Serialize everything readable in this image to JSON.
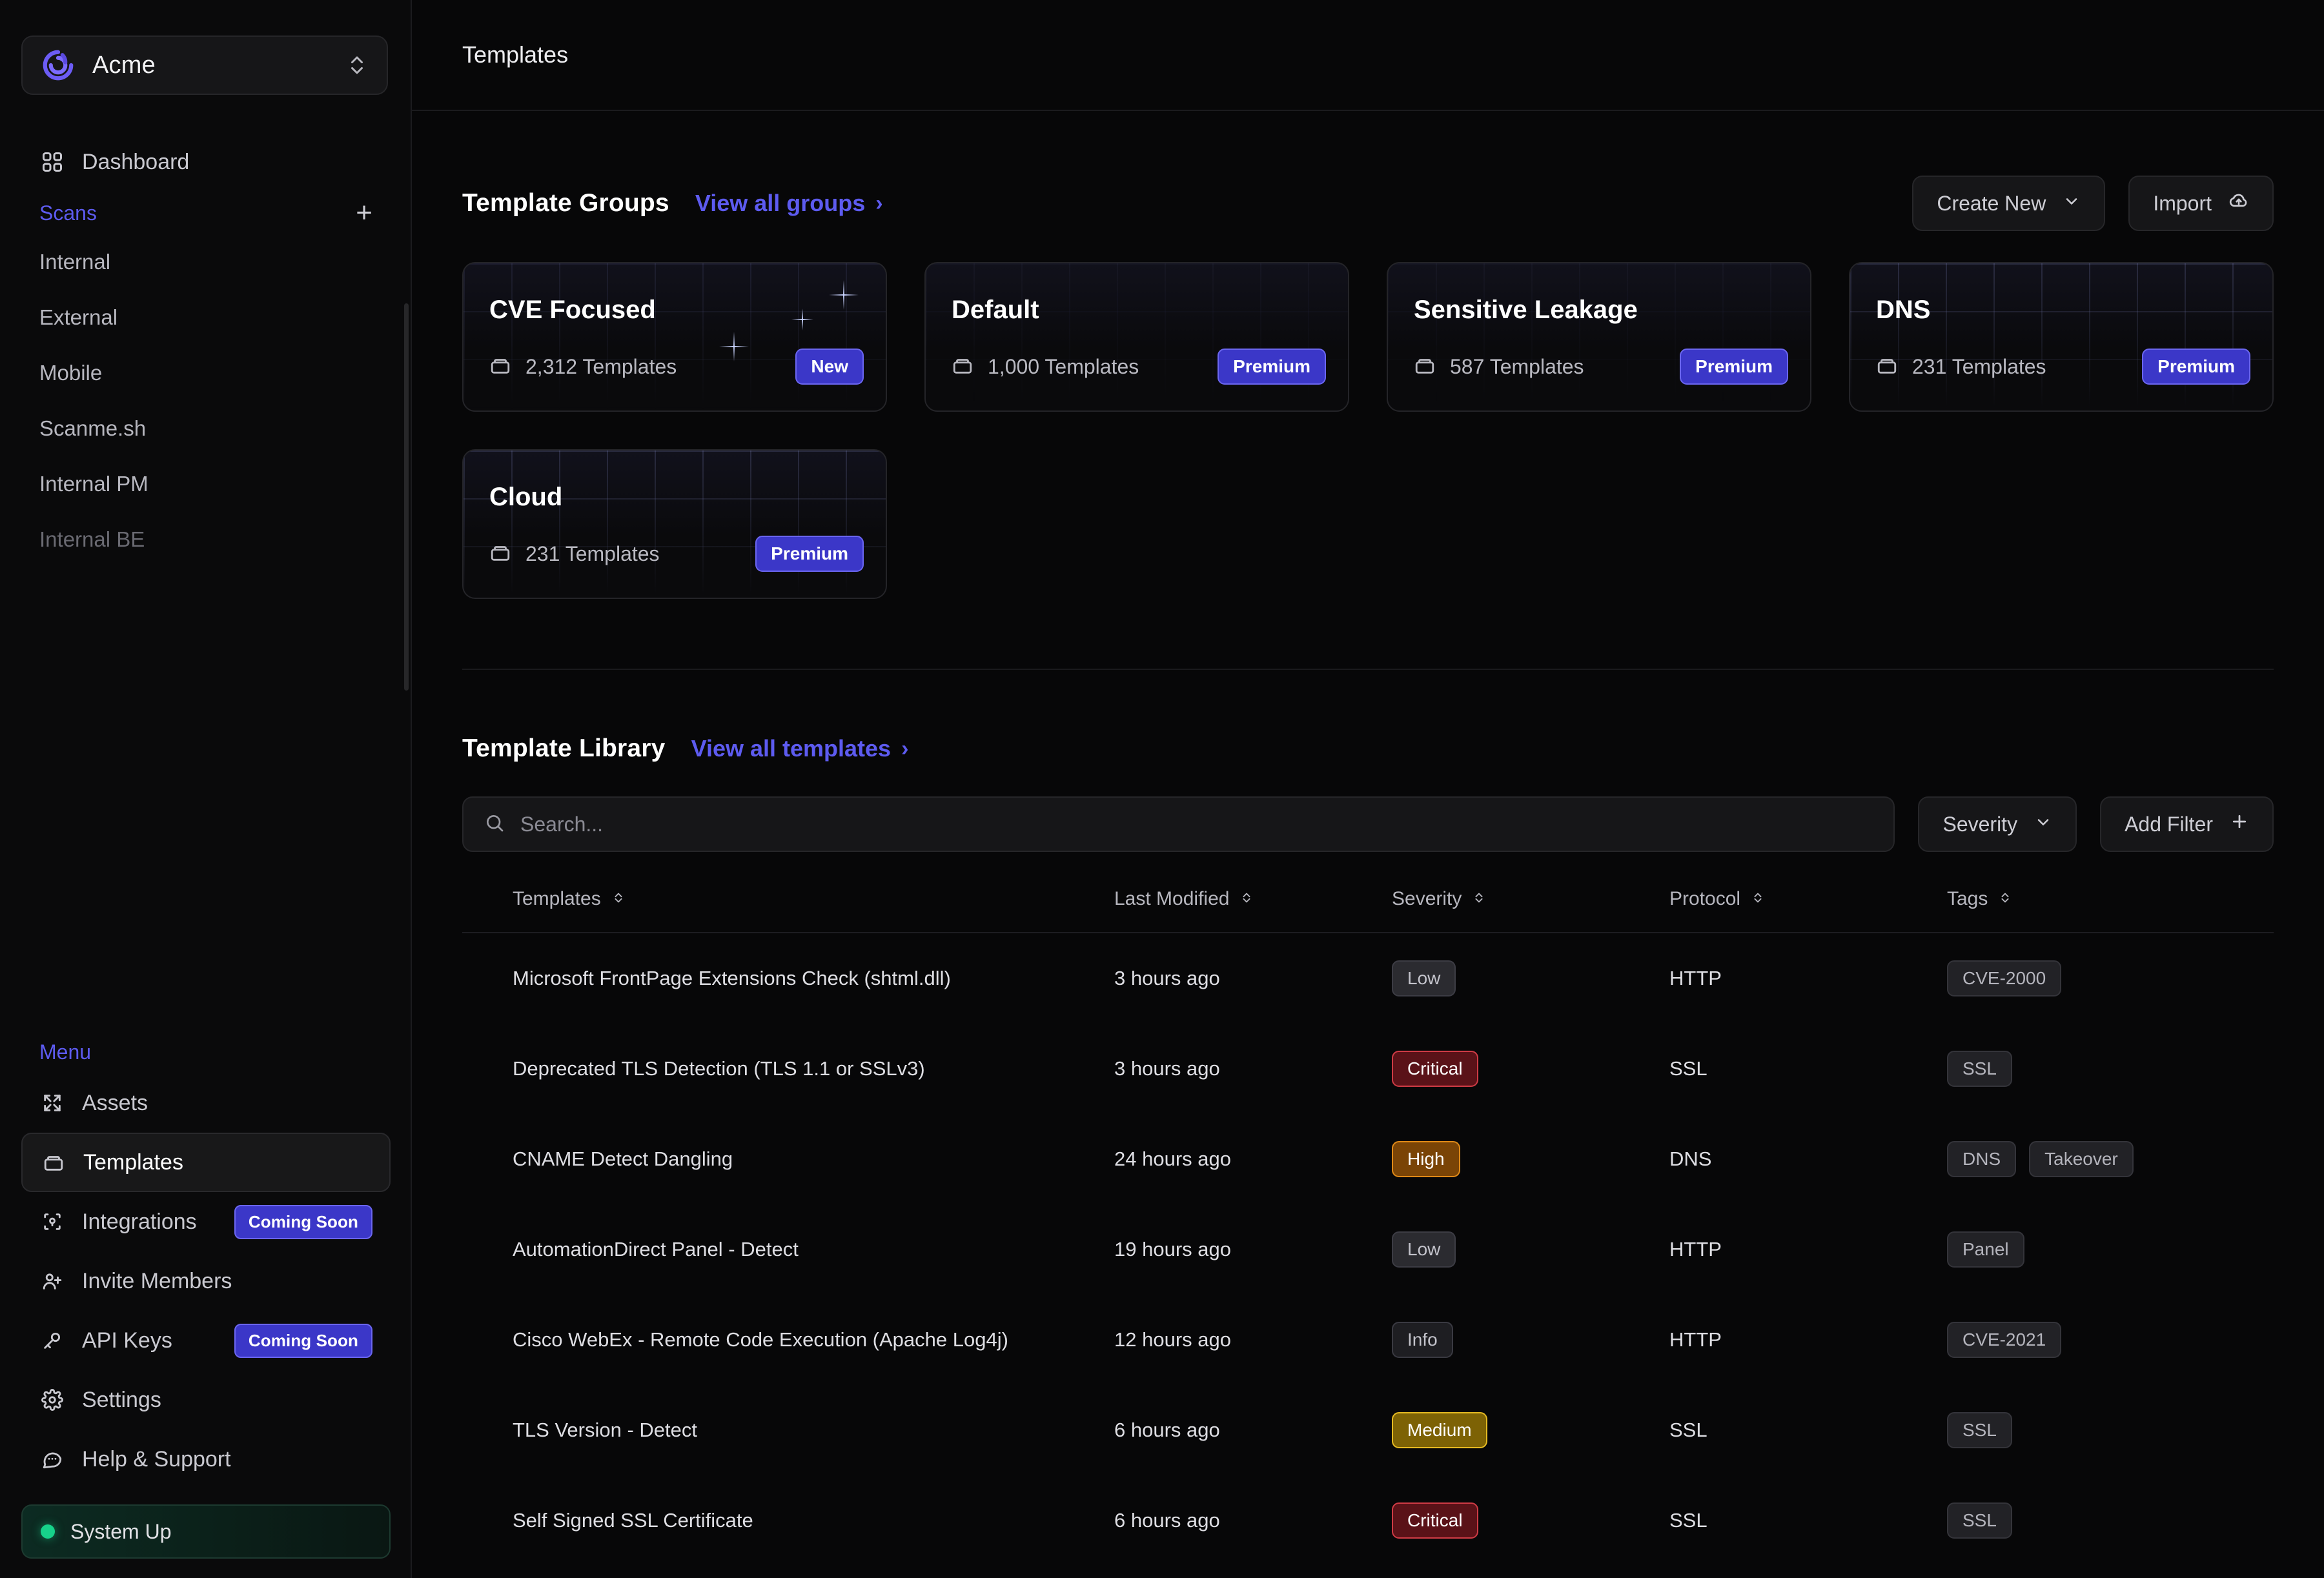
{
  "sidebar": {
    "org": {
      "name": "Acme",
      "logo_icon": "spiral-logo-icon",
      "switch_icon": "chevron-up-down-icon"
    },
    "dashboard": {
      "label": "Dashboard",
      "icon": "grid-icon"
    },
    "scans": {
      "label": "Scans",
      "add_icon": "plus-icon",
      "items": [
        {
          "label": "Internal"
        },
        {
          "label": "External"
        },
        {
          "label": "Mobile"
        },
        {
          "label": "Scanme.sh"
        },
        {
          "label": "Internal PM"
        },
        {
          "label": "Internal BE"
        }
      ]
    },
    "menu": {
      "label": "Menu",
      "items": [
        {
          "label": "Assets",
          "icon": "expand-icon",
          "badge": ""
        },
        {
          "label": "Templates",
          "icon": "box-icon",
          "badge": "",
          "active": true
        },
        {
          "label": "Integrations",
          "icon": "integration-icon",
          "badge": "Coming Soon"
        },
        {
          "label": "Invite Members",
          "icon": "user-plus-icon",
          "badge": ""
        },
        {
          "label": "API Keys",
          "icon": "key-icon",
          "badge": "Coming Soon"
        },
        {
          "label": "Settings",
          "icon": "gear-icon",
          "badge": ""
        },
        {
          "label": "Help & Support",
          "icon": "chat-icon",
          "badge": ""
        }
      ]
    },
    "status": {
      "label": "System Up",
      "color": "#17d28a"
    }
  },
  "header": {
    "title": "Templates"
  },
  "template_groups": {
    "title": "Template Groups",
    "view_all": "View all groups",
    "create_new": "Create New",
    "import": "Import",
    "cards": [
      {
        "name": "CVE Focused",
        "count": "2,312 Templates",
        "badge": "New",
        "style": "sparkle"
      },
      {
        "name": "Default",
        "count": "1,000 Templates",
        "badge": "Premium",
        "style": "faint"
      },
      {
        "name": "Sensitive Leakage",
        "count": "587 Templates",
        "badge": "Premium",
        "style": "faint"
      },
      {
        "name": "DNS",
        "count": "231 Templates",
        "badge": "Premium",
        "style": "bright"
      },
      {
        "name": "Cloud",
        "count": "231 Templates",
        "badge": "Premium",
        "style": "bright"
      }
    ]
  },
  "template_library": {
    "title": "Template Library",
    "view_all": "View all templates",
    "search_placeholder": "Search...",
    "search_value": "",
    "severity_filter": "Severity",
    "add_filter": "Add Filter",
    "columns": [
      "Templates",
      "Last Modified",
      "Severity",
      "Protocol",
      "Tags"
    ],
    "rows": [
      {
        "name": "Microsoft FrontPage Extensions Check (shtml.dll)",
        "modified": "3 hours ago",
        "severity": "Low",
        "protocol": "HTTP",
        "tags": [
          "CVE-2000"
        ]
      },
      {
        "name": "Deprecated TLS Detection (TLS 1.1 or SSLv3)",
        "modified": "3 hours ago",
        "severity": "Critical",
        "protocol": "SSL",
        "tags": [
          "SSL"
        ]
      },
      {
        "name": "CNAME Detect Dangling",
        "modified": "24 hours ago",
        "severity": "High",
        "protocol": "DNS",
        "tags": [
          "DNS",
          "Takeover"
        ]
      },
      {
        "name": "AutomationDirect Panel - Detect",
        "modified": "19 hours ago",
        "severity": "Low",
        "protocol": "HTTP",
        "tags": [
          "Panel"
        ]
      },
      {
        "name": "Cisco WebEx - Remote Code Execution (Apache Log4j)",
        "modified": "12 hours ago",
        "severity": "Info",
        "protocol": "HTTP",
        "tags": [
          "CVE-2021"
        ]
      },
      {
        "name": "TLS Version - Detect",
        "modified": "6 hours ago",
        "severity": "Medium",
        "protocol": "SSL",
        "tags": [
          "SSL"
        ]
      },
      {
        "name": "Self Signed SSL Certificate",
        "modified": "6 hours ago",
        "severity": "Critical",
        "protocol": "SSL",
        "tags": [
          "SSL"
        ]
      }
    ]
  },
  "colors": {
    "accent": "#5d5bf0",
    "badge_bg": "#3b37c8",
    "status_green": "#17d28a",
    "critical": "#cf3b45",
    "high": "#e08a17",
    "medium": "#e6bb22",
    "low": "#3c3c44"
  }
}
